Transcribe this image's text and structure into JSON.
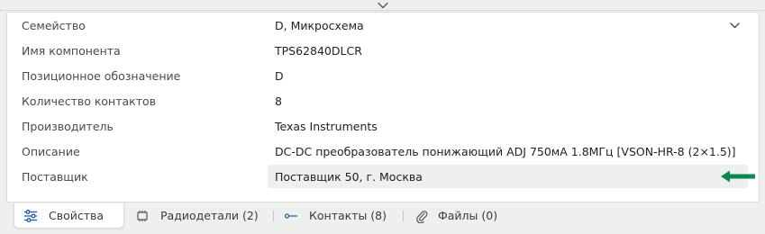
{
  "properties": {
    "rows": [
      {
        "label": "Семейство",
        "value": "D, Микросхема"
      },
      {
        "label": "Имя компонента",
        "value": "TPS62840DLCR"
      },
      {
        "label": "Позиционное обозначение",
        "value": "D"
      },
      {
        "label": "Количество контактов",
        "value": "8"
      },
      {
        "label": "Производитель",
        "value": "Texas Instruments"
      },
      {
        "label": "Описание",
        "value": "DC-DC преобразователь понижающий ADJ 750мА 1.8МГц [VSON-HR-8 (2×1.5)]"
      },
      {
        "label": "Поставщик",
        "value": "Поставщик 50, г. Москва"
      }
    ]
  },
  "tabs": [
    {
      "label": "Свойства",
      "icon": "sliders-icon",
      "active": true
    },
    {
      "label": "Радиодетали (2)",
      "icon": "chip-icon",
      "active": false
    },
    {
      "label": "Контакты (8)",
      "icon": "pin-icon",
      "active": false
    },
    {
      "label": "Файлы (0)",
      "icon": "paperclip-icon",
      "active": false
    }
  ],
  "colors": {
    "arrow": "#0a8a4a",
    "highlight_bg": "#eef0ef",
    "panel_bg": "#ffffff",
    "page_bg": "#eef0ef"
  }
}
